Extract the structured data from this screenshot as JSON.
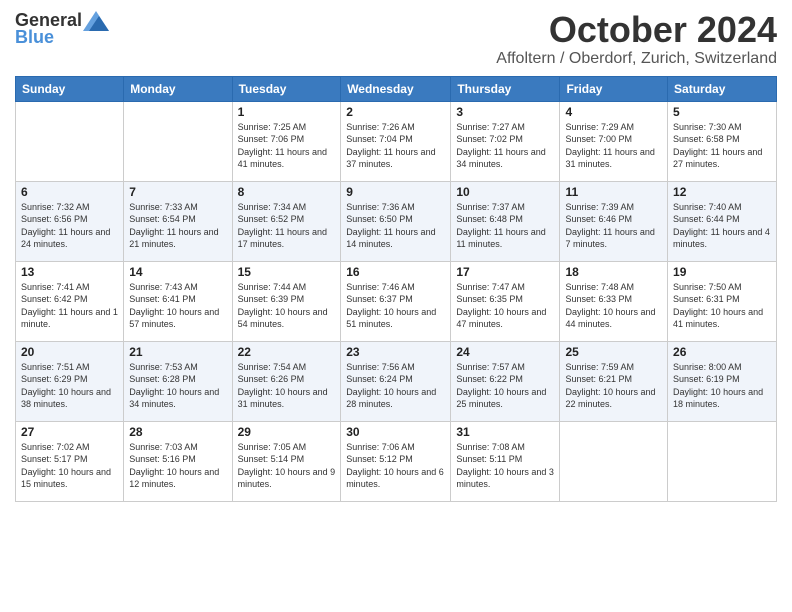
{
  "header": {
    "logo": {
      "general": "General",
      "blue": "Blue"
    },
    "title": "October 2024",
    "location": "Affoltern / Oberdorf, Zurich, Switzerland"
  },
  "calendar": {
    "days_of_week": [
      "Sunday",
      "Monday",
      "Tuesday",
      "Wednesday",
      "Thursday",
      "Friday",
      "Saturday"
    ],
    "weeks": [
      [
        {
          "day": "",
          "info": ""
        },
        {
          "day": "",
          "info": ""
        },
        {
          "day": "1",
          "info": "Sunrise: 7:25 AM\nSunset: 7:06 PM\nDaylight: 11 hours and 41 minutes."
        },
        {
          "day": "2",
          "info": "Sunrise: 7:26 AM\nSunset: 7:04 PM\nDaylight: 11 hours and 37 minutes."
        },
        {
          "day": "3",
          "info": "Sunrise: 7:27 AM\nSunset: 7:02 PM\nDaylight: 11 hours and 34 minutes."
        },
        {
          "day": "4",
          "info": "Sunrise: 7:29 AM\nSunset: 7:00 PM\nDaylight: 11 hours and 31 minutes."
        },
        {
          "day": "5",
          "info": "Sunrise: 7:30 AM\nSunset: 6:58 PM\nDaylight: 11 hours and 27 minutes."
        }
      ],
      [
        {
          "day": "6",
          "info": "Sunrise: 7:32 AM\nSunset: 6:56 PM\nDaylight: 11 hours and 24 minutes."
        },
        {
          "day": "7",
          "info": "Sunrise: 7:33 AM\nSunset: 6:54 PM\nDaylight: 11 hours and 21 minutes."
        },
        {
          "day": "8",
          "info": "Sunrise: 7:34 AM\nSunset: 6:52 PM\nDaylight: 11 hours and 17 minutes."
        },
        {
          "day": "9",
          "info": "Sunrise: 7:36 AM\nSunset: 6:50 PM\nDaylight: 11 hours and 14 minutes."
        },
        {
          "day": "10",
          "info": "Sunrise: 7:37 AM\nSunset: 6:48 PM\nDaylight: 11 hours and 11 minutes."
        },
        {
          "day": "11",
          "info": "Sunrise: 7:39 AM\nSunset: 6:46 PM\nDaylight: 11 hours and 7 minutes."
        },
        {
          "day": "12",
          "info": "Sunrise: 7:40 AM\nSunset: 6:44 PM\nDaylight: 11 hours and 4 minutes."
        }
      ],
      [
        {
          "day": "13",
          "info": "Sunrise: 7:41 AM\nSunset: 6:42 PM\nDaylight: 11 hours and 1 minute."
        },
        {
          "day": "14",
          "info": "Sunrise: 7:43 AM\nSunset: 6:41 PM\nDaylight: 10 hours and 57 minutes."
        },
        {
          "day": "15",
          "info": "Sunrise: 7:44 AM\nSunset: 6:39 PM\nDaylight: 10 hours and 54 minutes."
        },
        {
          "day": "16",
          "info": "Sunrise: 7:46 AM\nSunset: 6:37 PM\nDaylight: 10 hours and 51 minutes."
        },
        {
          "day": "17",
          "info": "Sunrise: 7:47 AM\nSunset: 6:35 PM\nDaylight: 10 hours and 47 minutes."
        },
        {
          "day": "18",
          "info": "Sunrise: 7:48 AM\nSunset: 6:33 PM\nDaylight: 10 hours and 44 minutes."
        },
        {
          "day": "19",
          "info": "Sunrise: 7:50 AM\nSunset: 6:31 PM\nDaylight: 10 hours and 41 minutes."
        }
      ],
      [
        {
          "day": "20",
          "info": "Sunrise: 7:51 AM\nSunset: 6:29 PM\nDaylight: 10 hours and 38 minutes."
        },
        {
          "day": "21",
          "info": "Sunrise: 7:53 AM\nSunset: 6:28 PM\nDaylight: 10 hours and 34 minutes."
        },
        {
          "day": "22",
          "info": "Sunrise: 7:54 AM\nSunset: 6:26 PM\nDaylight: 10 hours and 31 minutes."
        },
        {
          "day": "23",
          "info": "Sunrise: 7:56 AM\nSunset: 6:24 PM\nDaylight: 10 hours and 28 minutes."
        },
        {
          "day": "24",
          "info": "Sunrise: 7:57 AM\nSunset: 6:22 PM\nDaylight: 10 hours and 25 minutes."
        },
        {
          "day": "25",
          "info": "Sunrise: 7:59 AM\nSunset: 6:21 PM\nDaylight: 10 hours and 22 minutes."
        },
        {
          "day": "26",
          "info": "Sunrise: 8:00 AM\nSunset: 6:19 PM\nDaylight: 10 hours and 18 minutes."
        }
      ],
      [
        {
          "day": "27",
          "info": "Sunrise: 7:02 AM\nSunset: 5:17 PM\nDaylight: 10 hours and 15 minutes."
        },
        {
          "day": "28",
          "info": "Sunrise: 7:03 AM\nSunset: 5:16 PM\nDaylight: 10 hours and 12 minutes."
        },
        {
          "day": "29",
          "info": "Sunrise: 7:05 AM\nSunset: 5:14 PM\nDaylight: 10 hours and 9 minutes."
        },
        {
          "day": "30",
          "info": "Sunrise: 7:06 AM\nSunset: 5:12 PM\nDaylight: 10 hours and 6 minutes."
        },
        {
          "day": "31",
          "info": "Sunrise: 7:08 AM\nSunset: 5:11 PM\nDaylight: 10 hours and 3 minutes."
        },
        {
          "day": "",
          "info": ""
        },
        {
          "day": "",
          "info": ""
        }
      ]
    ]
  }
}
